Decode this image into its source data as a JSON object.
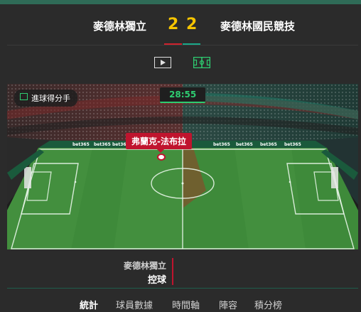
{
  "match": {
    "home_team": "麥德林獨立",
    "away_team": "麥德林國民競技",
    "home_score": "2",
    "away_score": "2",
    "home_color": "#d0222d",
    "away_color": "#1aa88a"
  },
  "view_toggle": {
    "video_icon": "play-video-icon",
    "pitch_icon": "pitch-icon"
  },
  "pitch": {
    "overlay_label": "進球得分手",
    "clock": "28:55",
    "player_label": "弗蘭克-法布拉",
    "ad_text": "bet365"
  },
  "possession": {
    "team": "麥德林獨立",
    "action": "控球"
  },
  "tabs": [
    {
      "label": "統計"
    },
    {
      "label": "球員數據"
    },
    {
      "label": "時間軸"
    },
    {
      "label": "陣容"
    },
    {
      "label": "積分榜"
    }
  ]
}
